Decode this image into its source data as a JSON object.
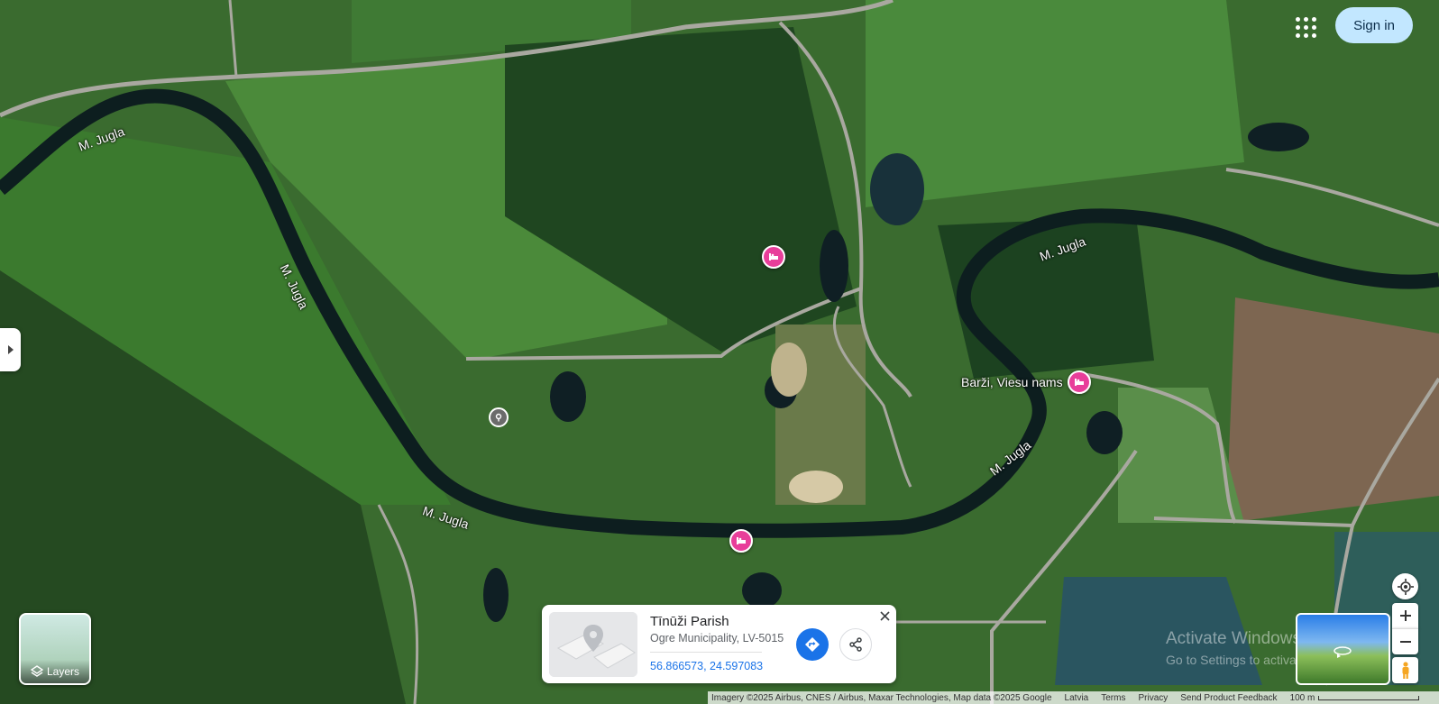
{
  "header": {
    "signin_label": "Sign in",
    "apps_icon": "apps-grid-icon"
  },
  "map": {
    "type": "satellite",
    "labels": {
      "river_nw": "M. Jugla",
      "river_w": "M. Jugla",
      "river_s": "M. Jugla",
      "river_ne": "M. Jugla",
      "river_e": "M. Jugla",
      "poi_barzi": "Barži, Viesu nams"
    },
    "poi_color": "#e83e9a"
  },
  "layers": {
    "label": "Layers"
  },
  "place_card": {
    "title": "Tīnūži Parish",
    "subtitle": "Ogre Municipality, LV-5015",
    "coordinates": "56.866573, 24.597083"
  },
  "watermark": {
    "line1": "Activate Windows",
    "line2": "Go to Settings to activate Windows."
  },
  "footer": {
    "attribution": "Imagery ©2025 Airbus, CNES / Airbus, Maxar Technologies, Map data ©2025 Google",
    "country": "Latvia",
    "terms": "Terms",
    "privacy": "Privacy",
    "feedback": "Send Product Feedback",
    "scale": "100 m"
  }
}
